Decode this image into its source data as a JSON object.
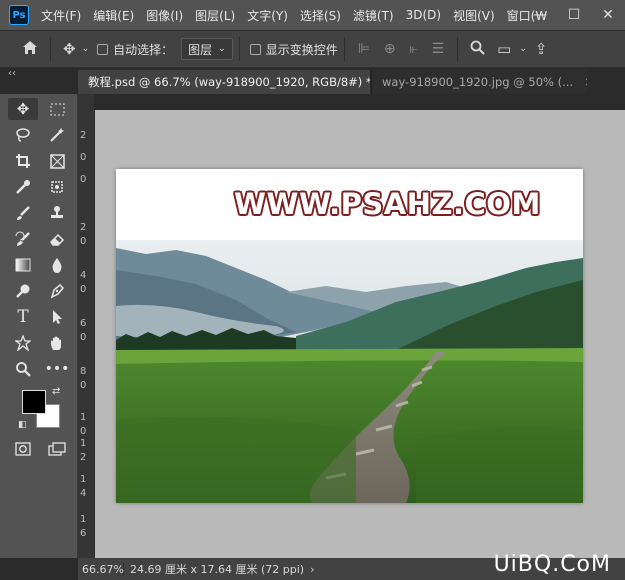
{
  "app": {
    "logo": "Ps"
  },
  "menu": [
    "文件(F)",
    "编辑(E)",
    "图像(I)",
    "图层(L)",
    "文字(Y)",
    "选择(S)",
    "滤镜(T)",
    "3D(D)",
    "视图(V)",
    "窗口(W"
  ],
  "window_controls": {
    "minimize": "—",
    "maximize": "☐",
    "close": "✕"
  },
  "options": {
    "auto_select_label": "自动选择：",
    "layer_dropdown_value": "图层",
    "show_transform_label": "显示变换控件"
  },
  "panel_collapse": "‹‹",
  "tabs": [
    {
      "label": "教程.psd @ 66.7% (way-918900_1920, RGB/8#) *",
      "close": "✕"
    },
    {
      "label": "way-918900_1920.jpg @ 50% (...",
      "close": "✕"
    }
  ],
  "ruler": [
    "2",
    "0",
    "0",
    "2",
    "0",
    "4",
    "0",
    "6",
    "0",
    "8",
    "0",
    "1",
    "0",
    "1",
    "2",
    "1",
    "4",
    "1",
    "6"
  ],
  "canvas": {
    "headline": "WWW.PSAHZ.COM"
  },
  "status": {
    "zoom": "66.67%",
    "doc_info": "24.69 厘米 x 17.64 厘米 (72 ppi)",
    "arrow": "›"
  },
  "watermark": "UiBQ.CoM",
  "colors": {
    "foreground": "#000000",
    "background": "#ffffff",
    "headline_outline": "#7d1f1f"
  }
}
